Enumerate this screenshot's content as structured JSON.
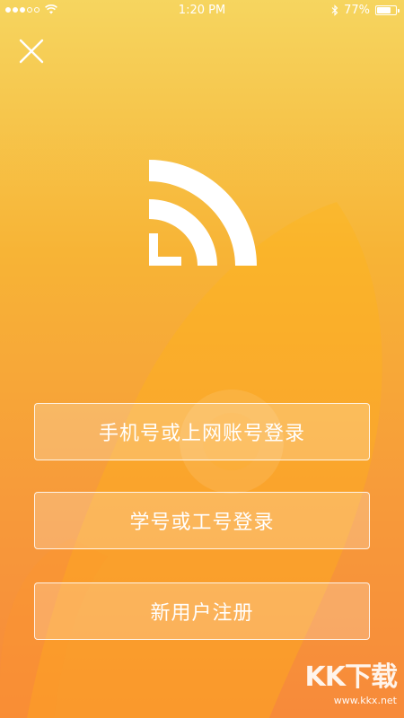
{
  "status_bar": {
    "time": "1:20 PM",
    "battery_text": "77%",
    "battery_level": 0.77,
    "signal_strength_dots": 3,
    "signal_total_dots": 5,
    "icons": [
      "wifi-icon",
      "bluetooth-icon",
      "battery-icon"
    ]
  },
  "header": {
    "close_icon": "close-icon"
  },
  "logo": {
    "icon": "wifi-signal-logo"
  },
  "buttons": {
    "phone_login": "手机号或上网账号登录",
    "student_login": "学号或工号登录",
    "register": "新用户注册"
  },
  "watermark": {
    "logo_text": "KK下载",
    "url": "www.kkx.net"
  },
  "colors": {
    "bg_top": "#f6d55f",
    "bg_bottom": "#f78a3a",
    "button_border": "#ffffff",
    "text": "#ffffff"
  }
}
